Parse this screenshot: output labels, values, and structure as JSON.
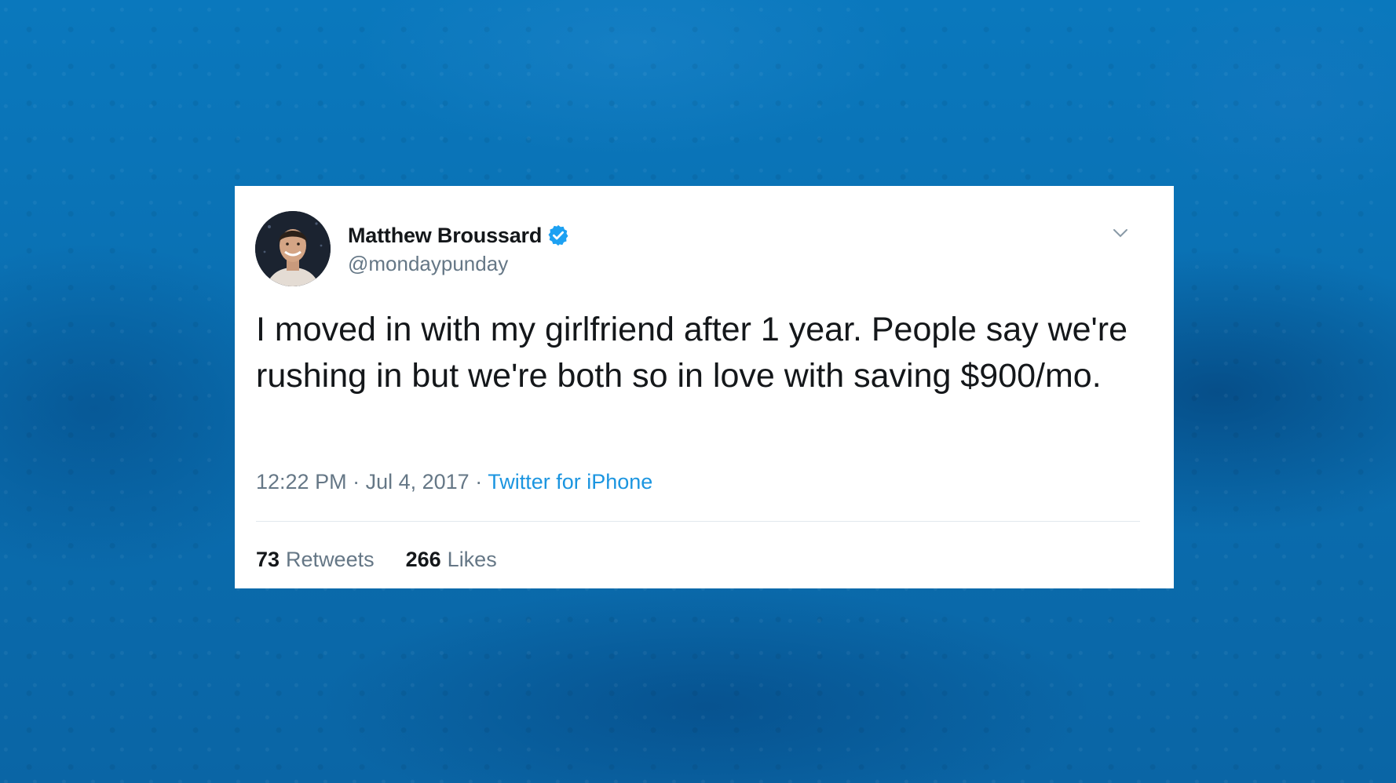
{
  "tweet": {
    "display_name": "Matthew Broussard",
    "handle": "@mondaypunday",
    "verified": true,
    "text": "I moved in with my girlfriend after 1 year. People say we're rushing in but we're both so in love with saving $900/mo.",
    "time": "12:22 PM",
    "date": "Jul 4, 2017",
    "separator": " · ",
    "source": "Twitter for iPhone",
    "retweets": {
      "count": "73",
      "label": "Retweets"
    },
    "likes": {
      "count": "266",
      "label": "Likes"
    }
  },
  "icons": {
    "verified": "verified-badge-icon",
    "menu": "chevron-down-icon"
  },
  "colors": {
    "background": "#0a6fb1",
    "card": "#ffffff",
    "text": "#14171a",
    "muted": "#657786",
    "link": "#1b95e0",
    "verified": "#1da1f2"
  }
}
